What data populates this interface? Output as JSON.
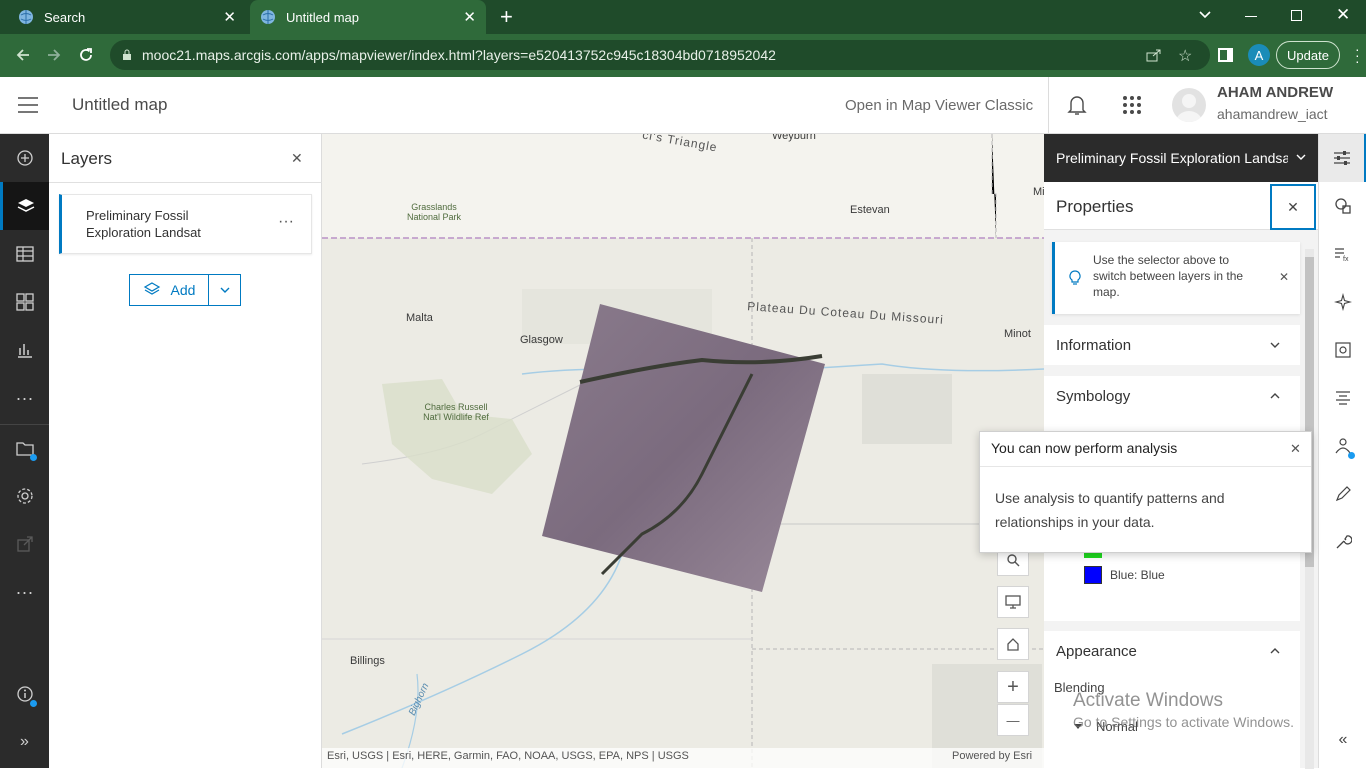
{
  "browser": {
    "tabs": [
      {
        "title": "Search",
        "close": "✕"
      },
      {
        "title": "Untitled map",
        "close": "✕"
      }
    ],
    "new_tab": "+",
    "url": "mooc21.maps.arcgis.com/apps/mapviewer/index.html?layers=e520413752c945c18304bd0718952042",
    "profile_initial": "A",
    "update_label": "Update"
  },
  "header": {
    "title": "Untitled map",
    "open_classic": "Open in Map Viewer Classic",
    "user_name": "AHAM ANDREW",
    "user_id": "ahamandrew_iact"
  },
  "layers_panel": {
    "title": "Layers",
    "layer_name": "Preliminary Fossil Exploration Landsat",
    "layer_menu": "···",
    "add_label": "Add"
  },
  "map": {
    "places": [
      "Weyburn",
      "Estevan",
      "Malta",
      "Glasgow",
      "Minot",
      "Billings",
      "Mi"
    ],
    "parks": [
      "Grasslands National Park",
      "Charles Russell Nat'l Wildlife Ref"
    ],
    "features": [
      "Plateau Du Coteau Du Missouri",
      "ci's Triangle",
      "Bighorn"
    ],
    "attribution": "Esri, USGS | Esri, HERE, Garmin, FAO, NOAA, USGS, EPA, NPS | USGS",
    "powered_by": "Powered by Esri",
    "controls": {
      "zoom_in": "+",
      "zoom_out": "—"
    }
  },
  "right_panel": {
    "layer_selector": "Preliminary Fossil Exploration Landsat",
    "properties_title": "Properties",
    "tip": "Use the selector above to switch between layers in the map.",
    "information": "Information",
    "symbology": "Symbology",
    "blue_label": "Blue: Blue",
    "appearance": "Appearance",
    "blending_label": "Blending",
    "blending_value": "Normal"
  },
  "popover": {
    "title": "You can now perform analysis",
    "body": "Use analysis to quantify patterns and relationships in your data."
  },
  "watermark": {
    "line1": "Activate Windows",
    "line2": "Go to Settings to activate Windows."
  },
  "colors": {
    "chrome_dark": "#1f4b2a",
    "chrome": "#2f6a3a",
    "accent": "#007ac2",
    "rail": "#2b2b2b"
  }
}
